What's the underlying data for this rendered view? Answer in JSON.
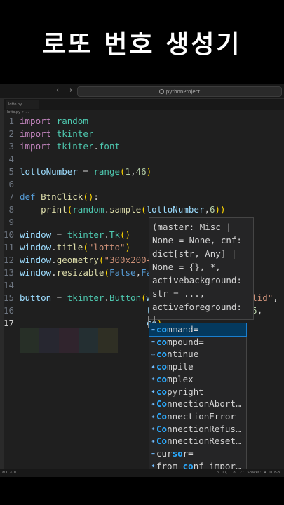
{
  "banner": {
    "title": "로또 번호 생성기"
  },
  "window": {
    "nav_back": "←",
    "nav_forward": "→",
    "search_label": "pythonProject",
    "tab_label": "lotto.py",
    "breadcrumb": "lotto.py > ..."
  },
  "editor": {
    "line_numbers": [
      "1",
      "2",
      "3",
      "4",
      "5",
      "6",
      "7",
      "8",
      "9",
      "10",
      "11",
      "12",
      "13",
      "14",
      "15",
      "16",
      "17"
    ],
    "active_line": "17"
  },
  "hover": {
    "lines": [
      "(master: Misc |",
      "None = None, cnf:",
      "dict[str, Any] |",
      "None = {}, *,",
      "activebackground:",
      "str = ...,",
      "activeforeground:"
    ]
  },
  "suggest": {
    "typed": "co",
    "items": [
      {
        "match": "co",
        "rest": "mmand=",
        "icon": "variable-icon",
        "glyph": "▬"
      },
      {
        "match": "co",
        "rest": "mpound=",
        "icon": "variable-icon",
        "glyph": "▬"
      },
      {
        "match": "co",
        "rest": "ntinue",
        "icon": "keyword-icon",
        "glyph": "▭"
      },
      {
        "match": "co",
        "rest": "mpile",
        "icon": "function-icon",
        "glyph": "◆"
      },
      {
        "match": "co",
        "rest": "mplex",
        "icon": "class-icon",
        "glyph": "◈"
      },
      {
        "match": "co",
        "rest": "pyright",
        "icon": "variable-icon",
        "glyph": "◆"
      },
      {
        "match": "Co",
        "rest": "nnectionAbort…",
        "icon": "class-icon",
        "glyph": "◈"
      },
      {
        "match": "Co",
        "rest": "nnectionError",
        "icon": "class-icon",
        "glyph": "◈"
      },
      {
        "match": "Co",
        "rest": "nnectionRefus…",
        "icon": "class-icon",
        "glyph": "◈"
      },
      {
        "match": "Co",
        "rest": "nnectionReset…",
        "icon": "class-icon",
        "glyph": "◈"
      },
      {
        "pre": "cur",
        "match": "so",
        "rest": "r=",
        "icon": "variable-icon",
        "glyph": "▬"
      },
      {
        "pre": "from_",
        "match": "co",
        "rest": "nf_impor…",
        "icon": "function-icon",
        "glyph": "◆"
      }
    ]
  },
  "status": {
    "left": "⊗ 0 ⚠ 0",
    "right": "Ln 17, Col 27 Spaces: 4 UTF-8"
  },
  "colors": {
    "background": "#1f1f1f",
    "keyword": "#569cd6",
    "string": "#ce9178",
    "function": "#dcdcaa",
    "variable": "#9cdcfe",
    "selection": "#04395e"
  }
}
